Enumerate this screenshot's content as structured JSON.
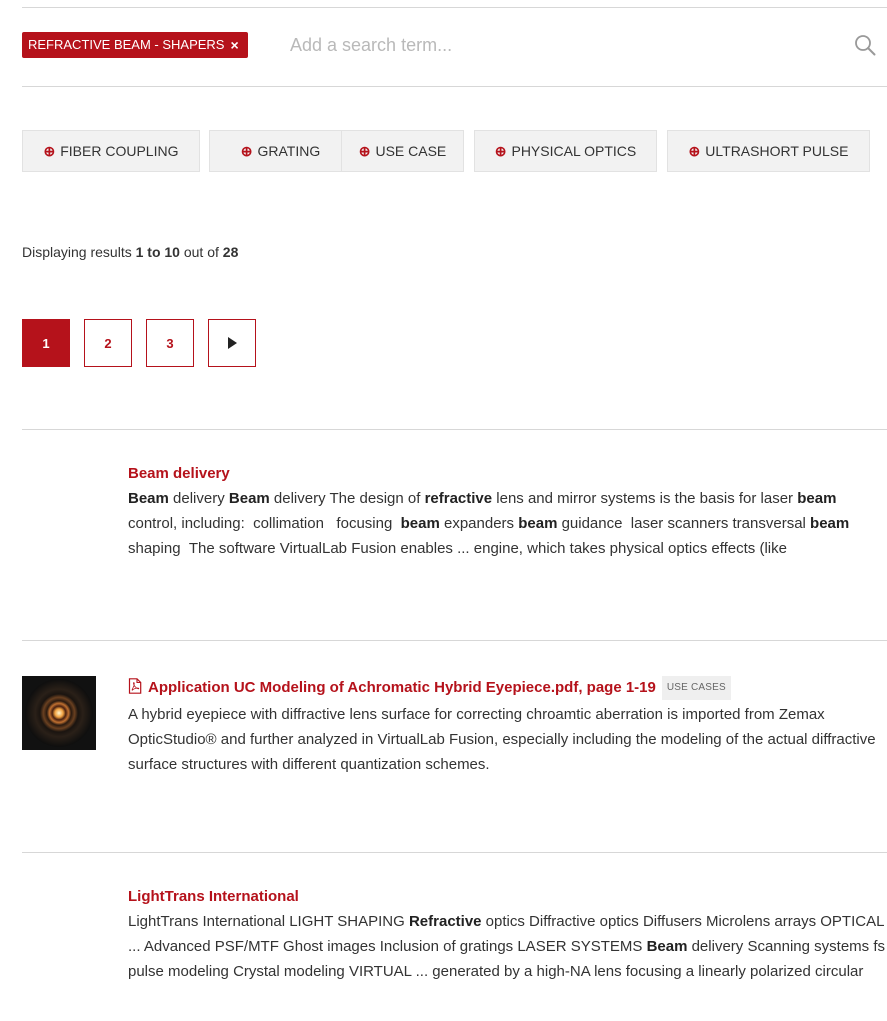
{
  "search": {
    "active_tag": "REFRACTIVE BEAM - SHAPERS",
    "remove_symbol": "×",
    "placeholder": "Add a search term...",
    "value": ""
  },
  "facets": [
    {
      "icon": "zoom-in-icon",
      "label": "FIBER COUPLING"
    },
    {
      "icon": "zoom-in-icon",
      "label": "GRATING"
    },
    {
      "icon": "zoom-in-icon",
      "label": "USE CASE"
    },
    {
      "icon": "zoom-in-icon",
      "label": "PHYSICAL OPTICS"
    },
    {
      "icon": "zoom-in-icon",
      "label": "ULTRASHORT PULSE"
    }
  ],
  "results_info": {
    "prefix": "Displaying results",
    "range": "1 to 10",
    "middle": "out of",
    "total": "28"
  },
  "pagination": {
    "pages": [
      "1",
      "2",
      "3"
    ],
    "current": "1",
    "next_symbol": "▶"
  },
  "results": [
    {
      "title": "Beam delivery",
      "body_html": "<b>Beam</b> delivery <b>Beam</b> delivery The design of <b>refractive</b> lens and mirror systems is the basis for laser <b>beam</b> control, including: &nbsp;collimation &nbsp;&nbsp;focusing &nbsp;<b>beam</b> expanders <b>beam</b> guidance &nbsp;laser scanners transversal <b>beam</b> shaping &nbsp;The software VirtualLab Fusion enables ... engine, which takes physical optics effects (like"
    },
    {
      "title": "Application UC Modeling of Achromatic Hybrid Eyepiece.pdf, page 1-19",
      "badge": "USE CASES",
      "icon": "pdf-icon",
      "body_html": "A hybrid eyepiece with diffractive lens surface for correcting chroamtic aberration is imported from Zemax OpticStudio® and further analyzed in VirtualLab Fusion, especially including the modeling of the actual diffractive surface structures with different quantization schemes."
    },
    {
      "title": "LightTrans International",
      "body_html": "LightTrans International LIGHT SHAPING <b>Refractive</b> optics Diffractive optics Diffusers Microlens arrays OPTICAL ... Advanced PSF/MTF Ghost images Inclusion of gratings LASER SYSTEMS <b>Beam</b> delivery Scanning systems fs pulse modeling Crystal modeling VIRTUAL ... generated by a high-NA lens focusing a linearly polarized circular"
    }
  ],
  "colors": {
    "accent": "#b5121b",
    "divider": "#d7d7d7",
    "facet_bg": "#f2f2f2"
  }
}
